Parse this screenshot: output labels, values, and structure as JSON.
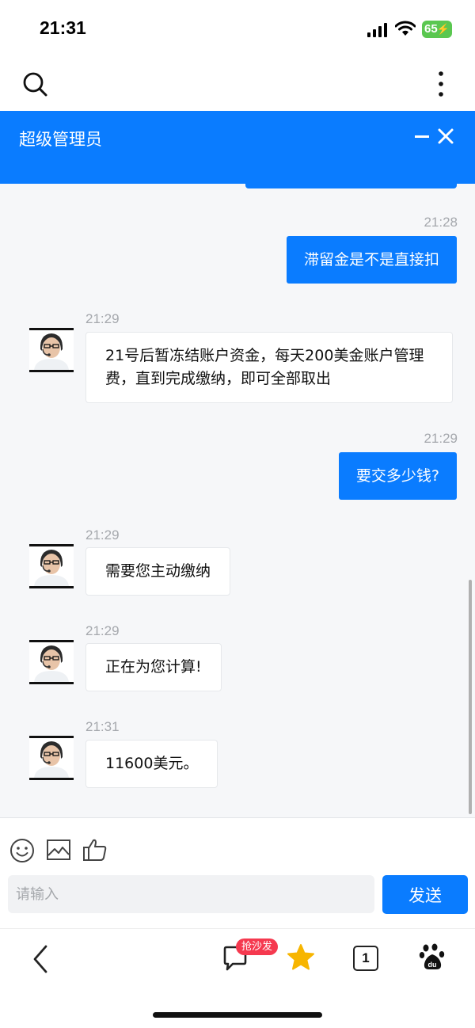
{
  "status_bar": {
    "time": "21:31",
    "battery": "65"
  },
  "chat": {
    "title": "超级管理员"
  },
  "messages": [
    {
      "direction": "out",
      "time": "21:28",
      "text": "滞留金是不是直接扣"
    },
    {
      "direction": "in",
      "time": "21:29",
      "text": "21号后暂冻结账户资金，每天200美金账户管理费，直到完成缴纳，即可全部取出"
    },
    {
      "direction": "out",
      "time": "21:29",
      "text": "要交多少钱?"
    },
    {
      "direction": "in",
      "time": "21:29",
      "text": "需要您主动缴纳"
    },
    {
      "direction": "in",
      "time": "21:29",
      "text": "正在为您计算!"
    },
    {
      "direction": "in",
      "time": "21:31",
      "text": "11600美元。"
    }
  ],
  "composer": {
    "placeholder": "请输入",
    "send_label": "发送"
  },
  "bottom_nav": {
    "badge": "抢沙发",
    "tab_count": "1"
  },
  "icons": [
    "search-icon",
    "more-vertical-icon",
    "minimize-icon",
    "close-icon",
    "smile-icon",
    "image-icon",
    "like-icon",
    "back-icon",
    "comment-icon",
    "star-icon",
    "tabs-icon",
    "paw-icon"
  ],
  "colors": {
    "accent": "#0a7cff",
    "badge": "#f5394f",
    "star": "#f7b500",
    "battery": "#5ac750"
  }
}
